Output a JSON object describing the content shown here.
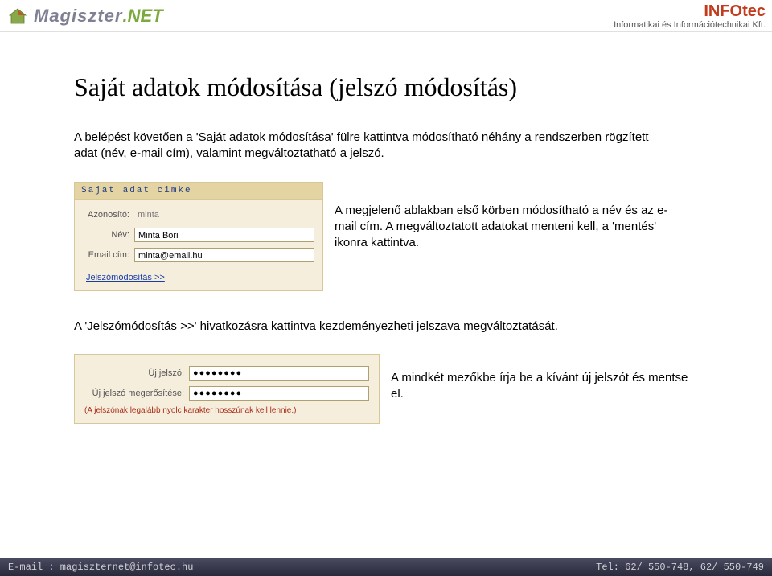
{
  "header": {
    "logo_mag": "Magiszter",
    "logo_net": ".NET",
    "brand": "INFOtec",
    "brand_sub": "Informatikai és Információtechnikai Kft."
  },
  "page": {
    "title": "Saját adatok módosítása (jelszó módosítás)",
    "intro": "A belépést követően a 'Saját adatok módosítása' fülre kattintva módosítható néhány a rendszerben rögzített adat (név, e-mail cím), valamint megváltoztatható a jelszó.",
    "panel1": {
      "title": "Sajat adat cimke",
      "id_label": "Azonosító:",
      "id_value": "minta",
      "name_label": "Név:",
      "name_value": "Minta Bori",
      "email_label": "Email cím:",
      "email_value": "minta@email.hu",
      "link": "Jelszómódosítás >>"
    },
    "side1": "A megjelenő ablakban első körben módosítható a név és az e-mail cím. A megváltoztatott adatokat menteni kell, a 'mentés' ikonra kattintva.",
    "mid": "A 'Jelszómódosítás >>' hivatkozásra kattintva kezdeményezheti jelszava megváltoztatását.",
    "panel2": {
      "p1_label": "Új jelszó:",
      "p1_value": "●●●●●●●●",
      "p2_label": "Új jelszó megerősítése:",
      "p2_value": "●●●●●●●●",
      "hint": "(A jelszónak legalább nyolc karakter hosszúnak kell lennie.)"
    },
    "side2": "A mindkét mezőkbe írja be a kívánt új jelszót és mentse el."
  },
  "footer": {
    "email": "E-mail : magiszternet@infotec.hu",
    "tel": "Tel: 62/ 550-748, 62/ 550-749"
  }
}
